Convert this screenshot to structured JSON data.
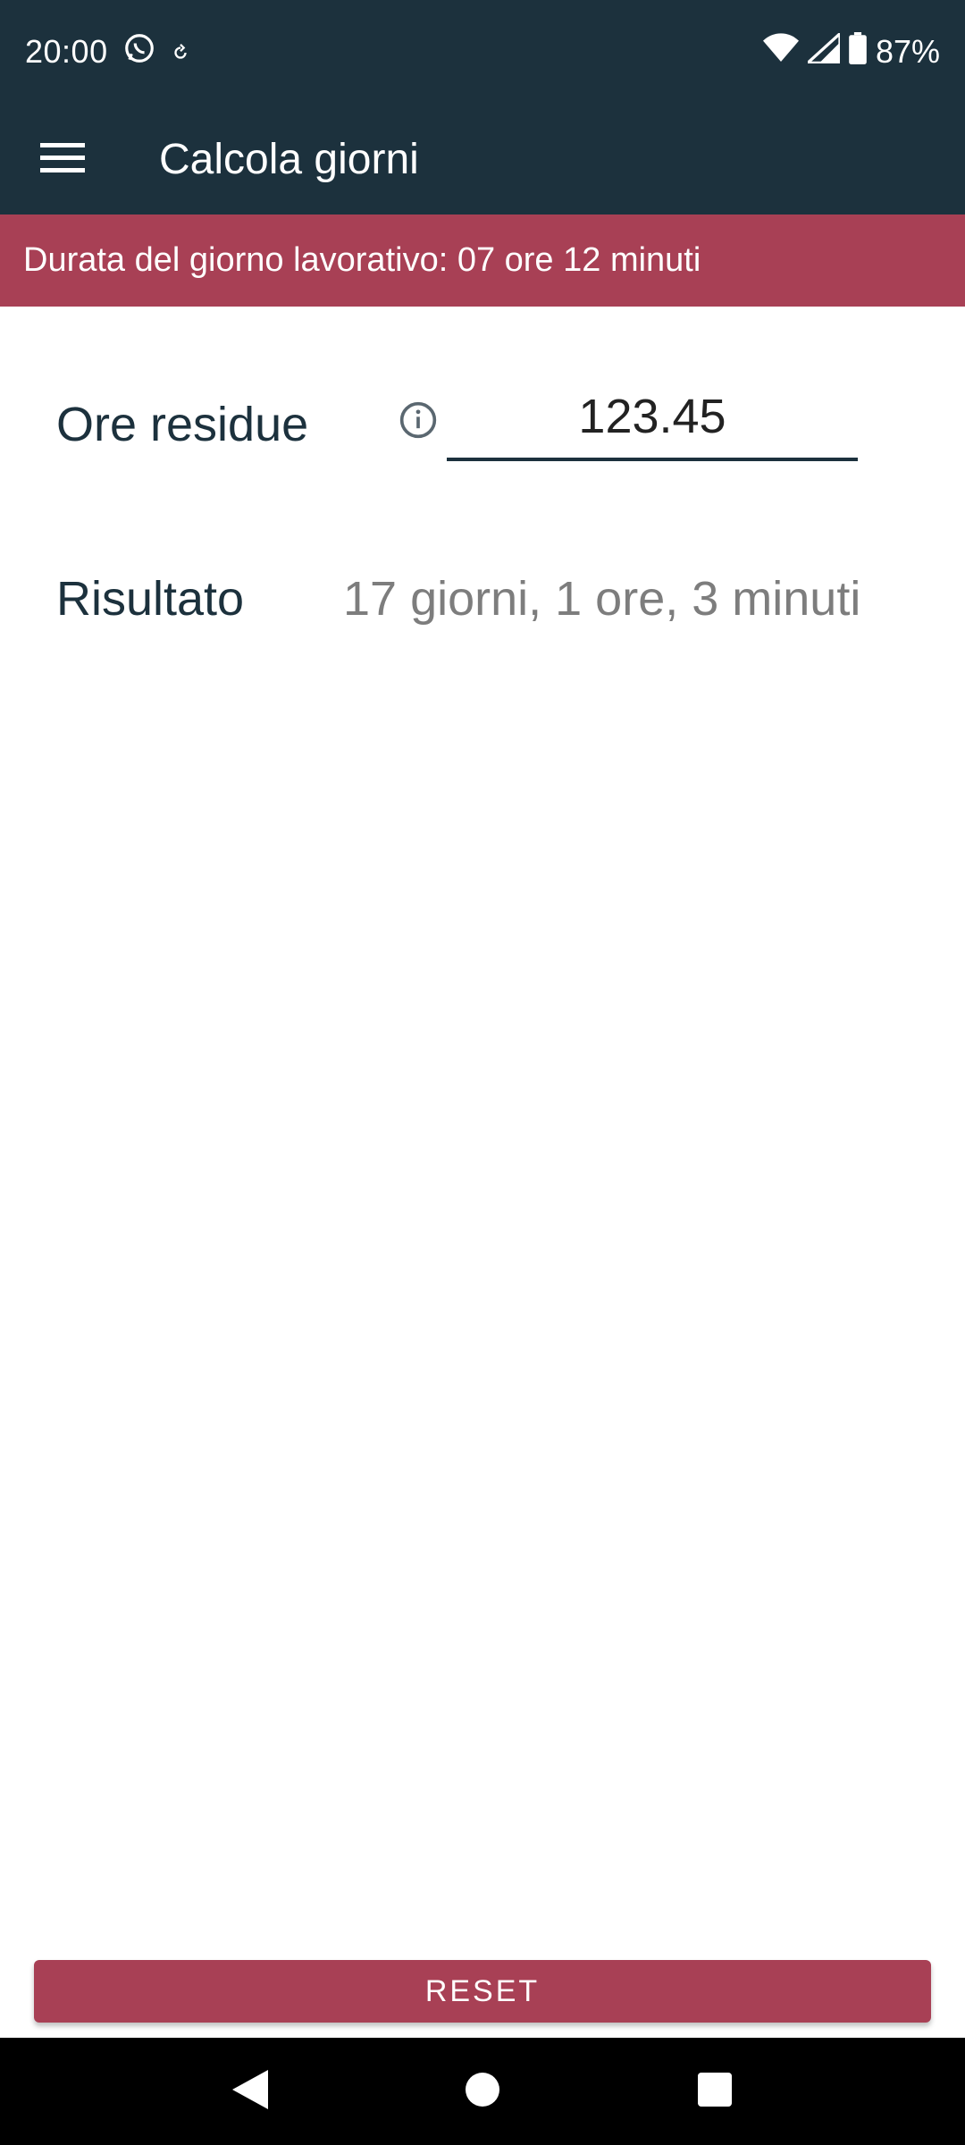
{
  "status_bar": {
    "time": "20:00",
    "battery": "87%",
    "icons": [
      "whatsapp-icon",
      "sync-icon",
      "wifi-icon",
      "signal-icon",
      "battery-icon"
    ]
  },
  "app_bar": {
    "title": "Calcola giorni",
    "menu_icon": "menu-icon"
  },
  "banner": {
    "text": "Durata del giorno lavorativo: 07 ore 12 minuti"
  },
  "form": {
    "ore_residue_label": "Ore residue",
    "ore_residue_value": "123.45",
    "risultato_label": "Risultato",
    "risultato_value": "17 giorni, 1 ore, 3 minuti"
  },
  "actions": {
    "reset_label": "RESET"
  },
  "colors": {
    "primary_dark": "#1c313d",
    "accent": "#a84055",
    "muted_text": "#7d7d7d"
  }
}
